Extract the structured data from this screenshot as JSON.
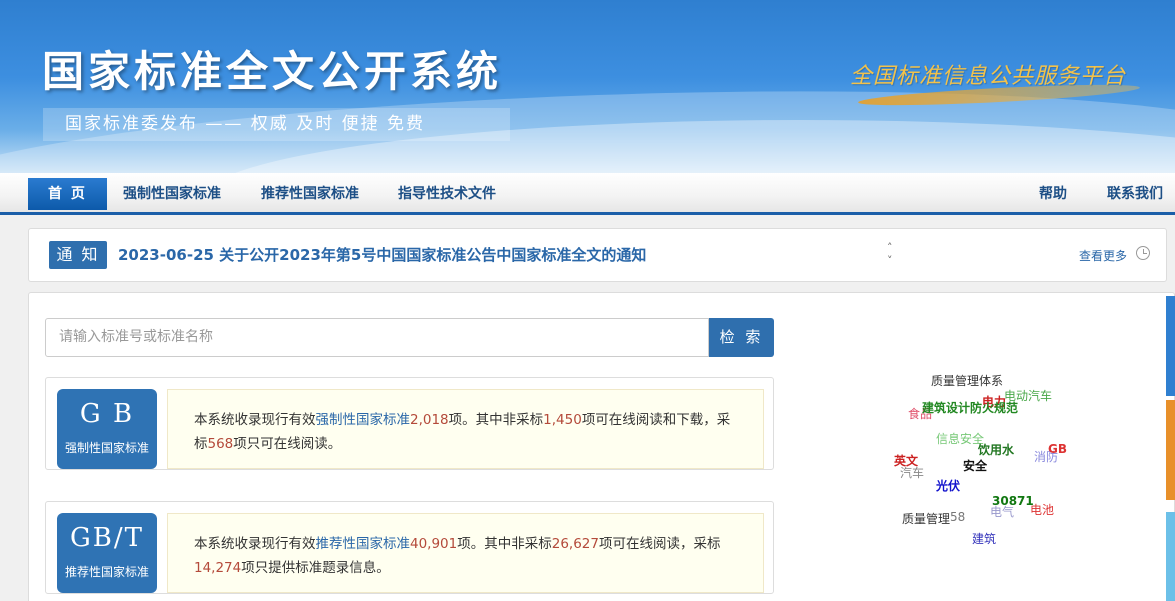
{
  "banner": {
    "title": "国家标准全文公开系统",
    "subtitle": "国家标准委发布 —— 权威 及时 便捷 免费",
    "platform": "全国标准信息公共服务平台"
  },
  "nav": {
    "items": [
      "首 页",
      "强制性国家标准",
      "推荐性国家标准",
      "指导性技术文件"
    ],
    "help": "帮助",
    "contact": "联系我们"
  },
  "notice": {
    "badge": "通 知",
    "text": "2023-06-25  关于公开2023年第5号中国国家标准公告中国家标准全文的通知",
    "more": "查看更多"
  },
  "search": {
    "placeholder": "请输入标准号或标准名称",
    "button": "检 索"
  },
  "cards": [
    {
      "code": "G B",
      "label": "强制性国家标准",
      "t1": "本系统收录现行有效",
      "t2": "强制性国家标准",
      "t3": "2,018",
      "t4": "项。其中非采标",
      "t5": "1,450",
      "t6": "项可在线阅读和下载，采标",
      "t7": "568",
      "t8": "项只可在线阅读。"
    },
    {
      "code": "GB/T",
      "label": "推荐性国家标准",
      "t1": "本系统收录现行有效",
      "t2": "推荐性国家标准",
      "t3": "40,901",
      "t4": "项。其中非采标",
      "t5": "26,627",
      "t6": "项可在线阅读，采标",
      "t7": "14,274",
      "t8": "项只提供标准题录信息。"
    }
  ],
  "cloud": [
    {
      "text": "质量管理体系",
      "color": "#333333"
    },
    {
      "text": "电动汽车",
      "color": "#4aa84a"
    },
    {
      "text": "电力",
      "color": "#cc2222"
    },
    {
      "text": "食品",
      "color": "#e0506a"
    },
    {
      "text": "建筑设计防火规范",
      "color": "#228822"
    },
    {
      "text": "信息安全",
      "color": "#77c877"
    },
    {
      "text": "饮用水",
      "color": "#227722"
    },
    {
      "text": "英文",
      "color": "#cc2222"
    },
    {
      "text": "消防",
      "color": "#8888dd"
    },
    {
      "text": "GB",
      "color": "#dd3333"
    },
    {
      "text": "汽车",
      "color": "#888888"
    },
    {
      "text": "安全",
      "color": "#111111"
    },
    {
      "text": "光伏",
      "color": "#1111cc"
    },
    {
      "text": "30871",
      "color": "#117711"
    },
    {
      "text": "电气",
      "color": "#9999cc"
    },
    {
      "text": "电池",
      "color": "#dd3333"
    },
    {
      "text": "质量管理",
      "color": "#333333"
    },
    {
      "text": "58",
      "color": "#777777"
    },
    {
      "text": "建筑",
      "color": "#3333bb"
    }
  ]
}
